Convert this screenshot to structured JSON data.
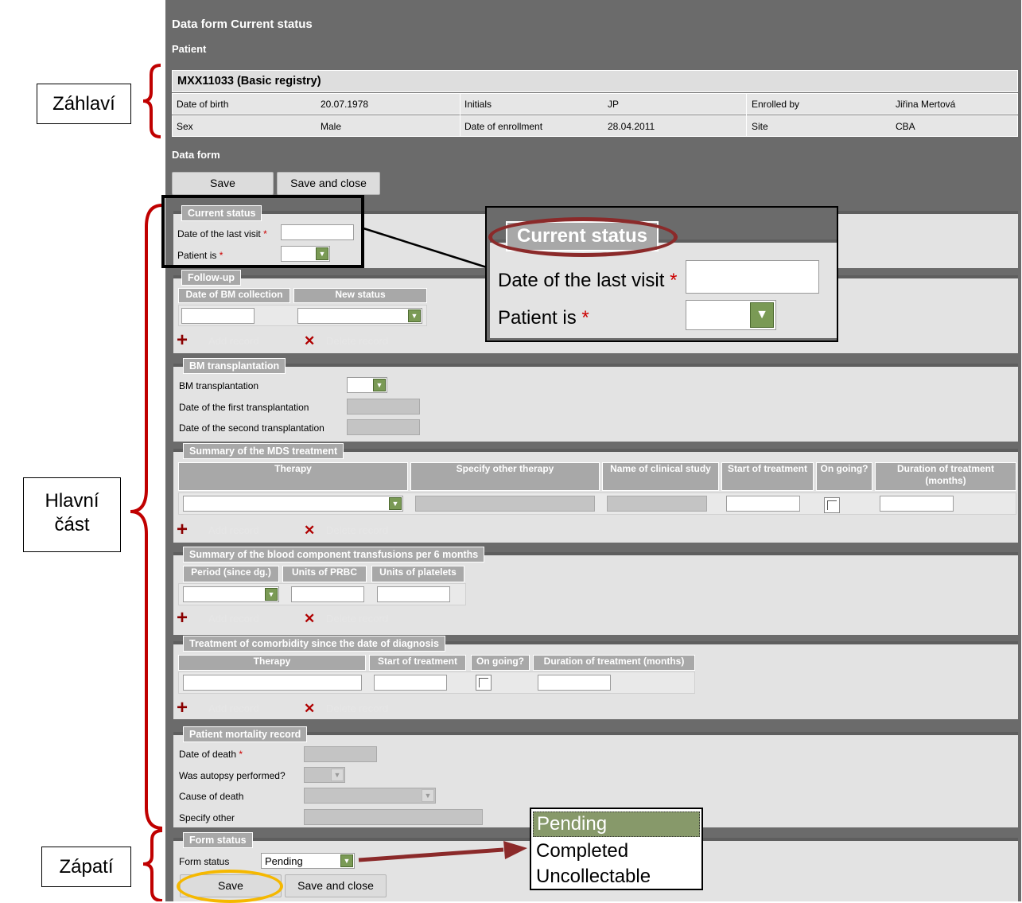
{
  "header": {
    "title": "Data form Current status",
    "patient_label": "Patient",
    "form_label": "Data form"
  },
  "patient": {
    "title": "MXX11033 (Basic registry)",
    "rows": [
      [
        "Date of birth",
        "20.07.1978",
        "Initials",
        "JP",
        "Enrolled by",
        "Jiřina Mertová"
      ],
      [
        "Sex",
        "Male",
        "Date of enrollment",
        "28.04.2011",
        "Site",
        "CBA"
      ]
    ]
  },
  "buttons": {
    "save": "Save",
    "save_close": "Save and close"
  },
  "current_status": {
    "legend": "Current status",
    "last_visit": "Date of the last visit",
    "patient_is": "Patient is",
    "required": "*"
  },
  "followup": {
    "legend": "Follow-up",
    "col1": "Date of BM collection",
    "col2": "New status"
  },
  "actions": {
    "add": "Add record",
    "delete": "Delete record"
  },
  "bm": {
    "legend": "BM transplantation",
    "l1": "BM transplantation",
    "l2": "Date of the first transplantation",
    "l3": "Date of the second transplantation"
  },
  "mds": {
    "legend": "Summary of the MDS treatment",
    "cols": [
      "Therapy",
      "Specify other therapy",
      "Name of clinical study",
      "Start of treatment",
      "On going?",
      "Duration of treatment (months)"
    ]
  },
  "blood": {
    "legend": "Summary of the blood component transfusions per 6 months",
    "cols": [
      "Period (since dg.)",
      "Units of PRBC",
      "Units of platelets"
    ]
  },
  "comorb": {
    "legend": "Treatment of comorbidity since the date of diagnosis",
    "cols": [
      "Therapy",
      "Start of treatment",
      "On going?",
      "Duration of treatment (months)"
    ]
  },
  "mortality": {
    "legend": "Patient mortality record",
    "l1": "Date of death",
    "l2": "Was autopsy performed?",
    "l3": "Cause of death",
    "l4": "Specify other"
  },
  "form_status": {
    "legend": "Form status",
    "label": "Form status",
    "value": "Pending",
    "options": [
      "Pending",
      "Completed",
      "Uncollectable"
    ]
  },
  "annotations": {
    "header": "Záhlaví",
    "main_1": "Hlavní",
    "main_2": "část",
    "footer": "Zápatí"
  },
  "zoom": {
    "legend": "Current status",
    "l1": "Date of the last visit",
    "l2": "Patient is",
    "required": "*"
  },
  "colors": {
    "panel": "#6b6b6b",
    "accent_red": "#b00000",
    "select_green": "#7a9a55",
    "highlight_orange": "#f5b800",
    "zoom_ellipse": "#8b2a2a"
  }
}
